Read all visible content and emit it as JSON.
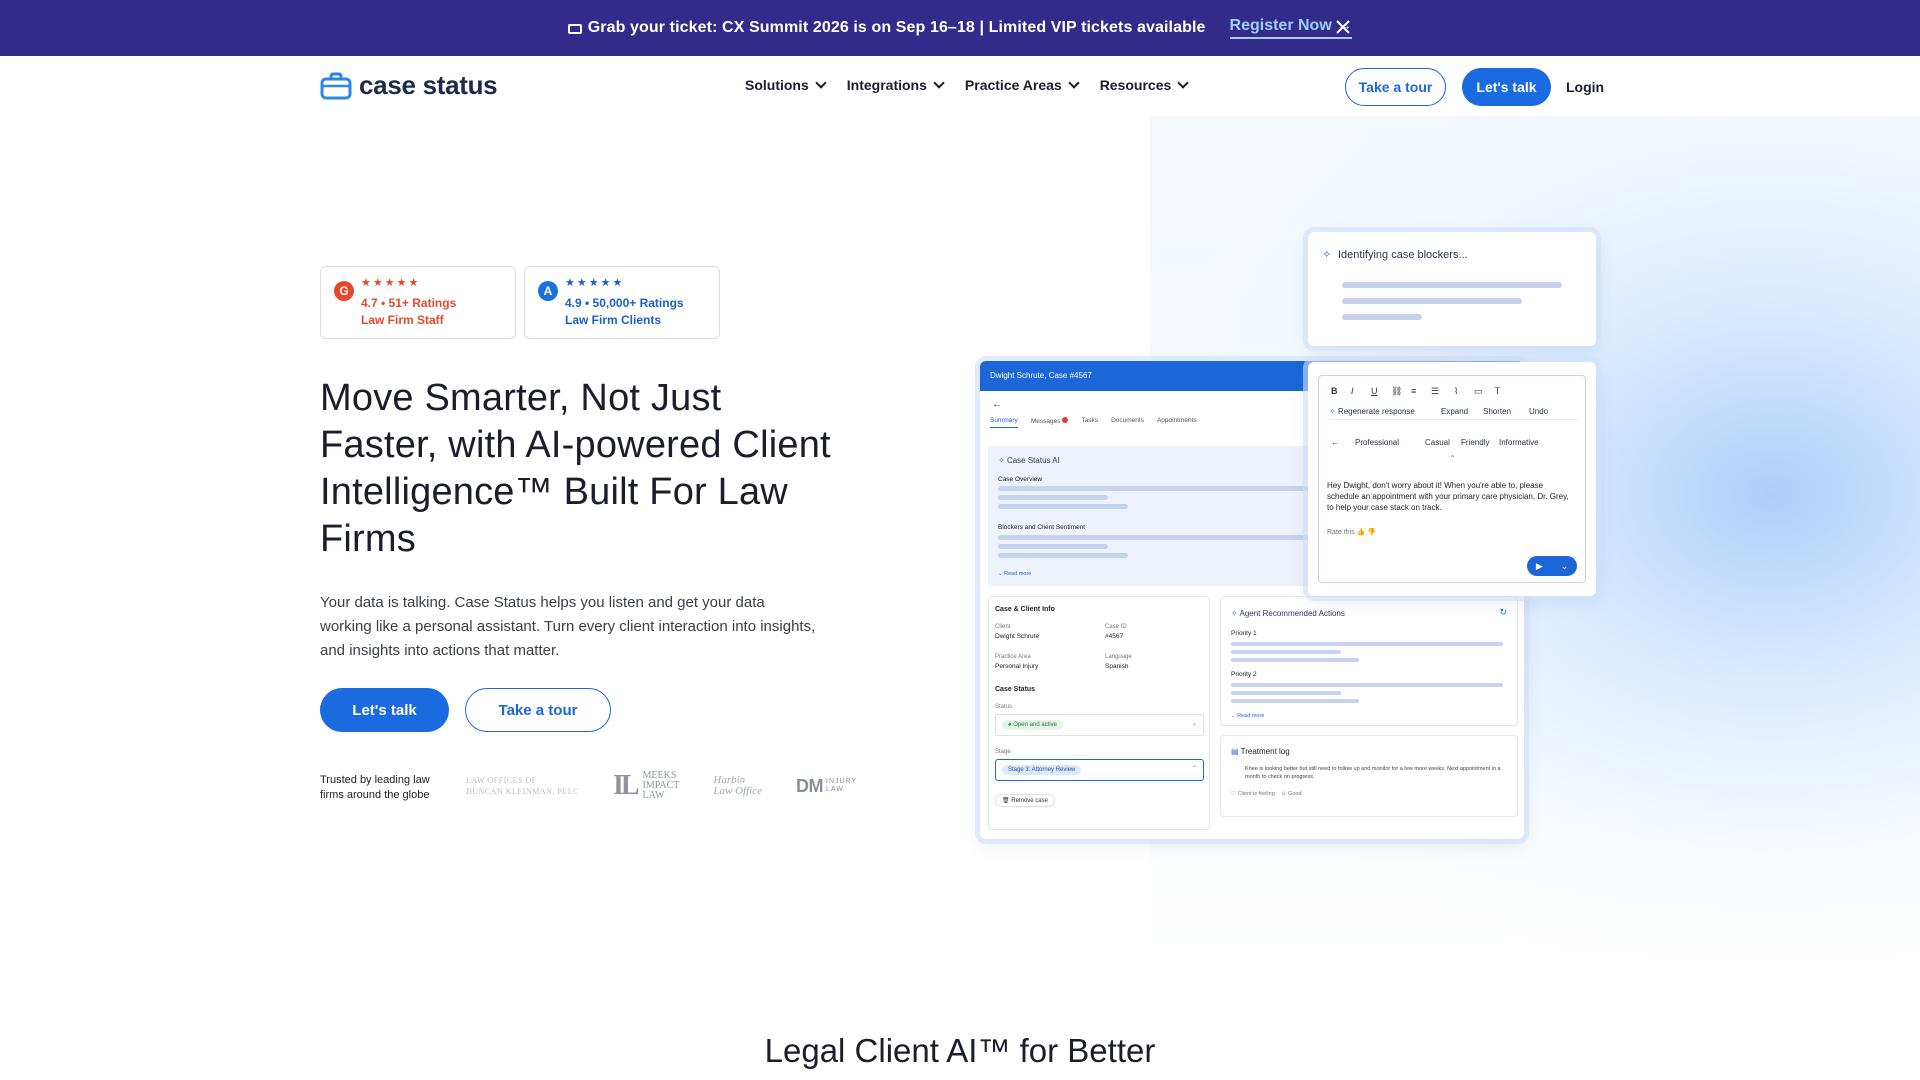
{
  "announcement": {
    "message": "Grab your ticket: CX Summit 2026 is on Sep 16–18 | Limited VIP tickets available",
    "cta": "Register Now"
  },
  "nav": {
    "brand": "case status",
    "menu": [
      "Solutions",
      "Integrations",
      "Practice Areas",
      "Resources"
    ],
    "take_tour": "Take a tour",
    "lets_talk": "Let's talk",
    "login": "Login"
  },
  "ratings": [
    {
      "icon": "g2-icon",
      "stars": "★★★★★",
      "line1": "4.7 • 51+ Ratings",
      "line2": "Law Firm Staff"
    },
    {
      "icon": "app-store-icon",
      "stars": "★★★★★",
      "line1": "4.9 • 50,000+ Ratings",
      "line2": "Law Firm Clients"
    }
  ],
  "hero": {
    "title": "Move Smarter, Not Just Faster, with AI-powered Client Intelligence™ Built For Law Firms",
    "description": "Your data is talking. Case Status helps you listen and get your data working like a personal assistant. Turn every client interaction into insights, and insights into actions that matter.",
    "lets_talk": "Let's talk",
    "take_tour": "Take a tour",
    "trusted": "Trusted by leading law firms around the globe"
  },
  "trusted_logos": {
    "logo1": [
      "LAW OFFICES OF",
      "DUNCAN KLEINMAN, PLLC"
    ],
    "logo2_mark": "IL",
    "logo2_text": [
      "MEEKS",
      "IMPACT",
      "LAW"
    ],
    "logo3": [
      "Harbin",
      "Law Office"
    ],
    "logo4_mark": "DM",
    "logo4_text": [
      "INJURY",
      "LAW"
    ]
  },
  "mockup": {
    "header": "Dwight Schrute, Case #4567",
    "tabs": [
      "Summary",
      "Messages",
      "Tasks",
      "Documents",
      "Appointments"
    ],
    "ai_title": "Case Status AI",
    "case_overview": "Case Overview",
    "blockers": "Blockers and Client Sentiment",
    "read_more": "Read more",
    "client_info": {
      "title": "Case & Client Info",
      "client_label": "Client",
      "client": "Dwight Schrute",
      "case_id_label": "Case ID",
      "case_id": "#4567",
      "practice_label": "Practice Area",
      "practice": "Personal Injury",
      "language_label": "Language",
      "language": "Spanish",
      "case_status": "Case Status",
      "status_label": "Status",
      "status": "Open and active",
      "stage_label": "Stage",
      "stage": "Stage 3: Attorney Review",
      "remove": "Remove case"
    },
    "actions": {
      "title": "Agent Recommended Actions",
      "priority1": "Priority 1",
      "priority2": "Priority 2",
      "read_more": "Read more"
    },
    "treatment": {
      "title": "Treatment log",
      "text": "Knee is looking better but still need to follow up and monitor for a few more weeks. Next appointment in a month to check on progress.",
      "tag1": "Client is feeling",
      "tag2": "Good"
    },
    "blockers_panel": "Identifying case blockers...",
    "editor": {
      "regenerate": "Regenerate response",
      "expand": "Expand",
      "shorten": "Shorten",
      "undo": "Undo",
      "tones": [
        "Professional",
        "Casual",
        "Friendly",
        "Informative"
      ],
      "message": "Hey Dwight, don't worry about it! When you're able to, please schedule an appointment with your primary care physician, Dr. Grey, to help your case stack on track.",
      "rate": "Rate this"
    }
  },
  "section_title": "Legal Client AI™ for Better",
  "colors": {
    "accent": "#1a6be0",
    "announcement_bg": "#332b8a",
    "g2": "#e8472e"
  }
}
